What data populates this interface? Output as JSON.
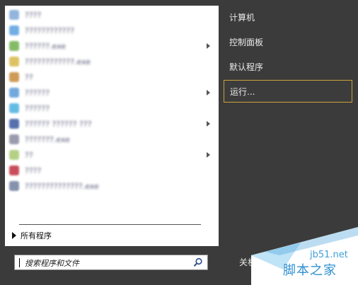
{
  "left_panel": {
    "programs": [
      {
        "label": "????",
        "icon": "app-icon",
        "color": "#7fa8d8",
        "has_submenu": false
      },
      {
        "label": "????????????",
        "icon": "app-icon",
        "color": "#5aa0e0",
        "has_submenu": false
      },
      {
        "label": "??????.exe",
        "icon": "app-icon",
        "color": "#6fb04a",
        "has_submenu": true
      },
      {
        "label": "????????????.exe",
        "icon": "app-icon",
        "color": "#d8b84a",
        "has_submenu": false
      },
      {
        "label": "??",
        "icon": "app-icon",
        "color": "#c58a3a",
        "has_submenu": false
      },
      {
        "label": "??????",
        "icon": "app-icon",
        "color": "#5a9ad8",
        "has_submenu": true
      },
      {
        "label": "??????",
        "icon": "app-icon",
        "color": "#4ab0e0",
        "has_submenu": false
      },
      {
        "label": "?????? ?????? ???",
        "icon": "app-icon",
        "color": "#3a58a0",
        "has_submenu": true
      },
      {
        "label": "???????.exe",
        "icon": "app-icon",
        "color": "#8a8aa0",
        "has_submenu": false
      },
      {
        "label": "??",
        "icon": "app-icon",
        "color": "#a8c870",
        "has_submenu": true
      },
      {
        "label": "????",
        "icon": "app-icon",
        "color": "#c03040",
        "has_submenu": false
      },
      {
        "label": "??????????????.exe",
        "icon": "app-icon",
        "color": "#7080a0",
        "has_submenu": false
      }
    ],
    "all_programs_label": "所有程序"
  },
  "search": {
    "placeholder": "搜索程序和文件"
  },
  "right_panel": {
    "items": [
      {
        "label": "计算机",
        "selected": false
      },
      {
        "label": "控制面板",
        "selected": false
      },
      {
        "label": "默认程序",
        "selected": false
      },
      {
        "label": "运行...",
        "selected": true
      }
    ],
    "shutdown_label": "关机"
  },
  "watermark": {
    "domain": "jb51.net",
    "name": "脚本之家"
  },
  "colors": {
    "background": "#3b3b3b",
    "selection_border": "#c9a23b",
    "watermark": "#2f8fd0"
  }
}
